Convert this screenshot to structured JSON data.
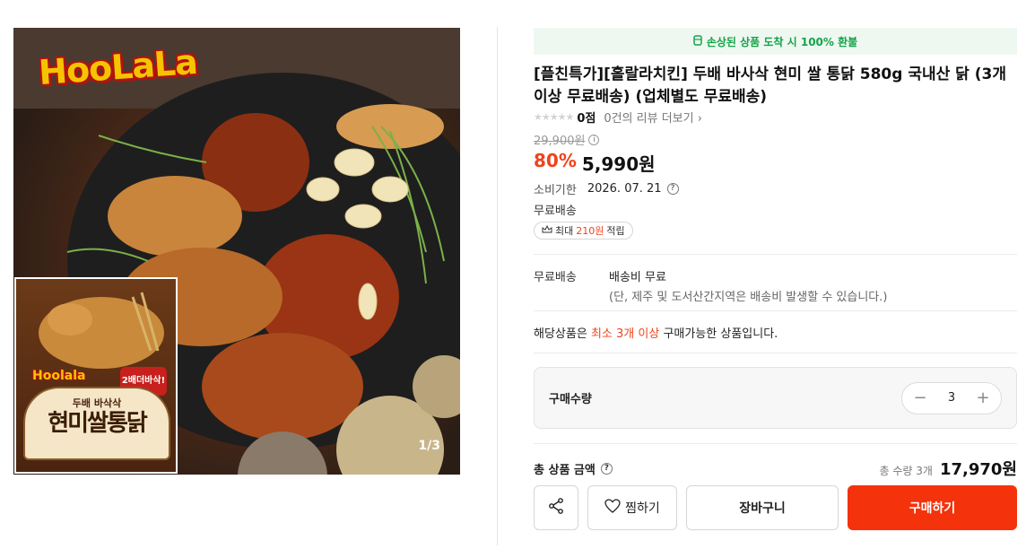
{
  "gallery": {
    "logo_text": "HooLaLa",
    "package": {
      "logo": "Hoolala",
      "subtitle": "두배 바삭삭",
      "title": "현미쌀통닭",
      "badge": "2배더바삭!"
    },
    "counter": "1/3"
  },
  "banner": {
    "icon": "box-icon",
    "text": "손상된 상품 도착 시 100% 환불"
  },
  "product": {
    "title": "[플친특가][홀랄라치킨] 두배 바사삭 현미 쌀 통닭 580g 국내산 닭 (3개이상 무료배송) (업체별도 무료배송)",
    "rating_score": "0점",
    "review_link": "0건의 리뷰 더보기",
    "original_price": "29,900원",
    "discount": "80%",
    "sale_price": "5,990원",
    "expiry_label": "소비기한",
    "expiry_value": "2026. 07. 21",
    "free_shipping": "무료배송",
    "points_prefix": "최대",
    "points_value": "210원",
    "points_suffix": "적립"
  },
  "shipping": {
    "label": "무료배송",
    "title": "배송비 무료",
    "note": "(단, 제주 및 도서산간지역은 배송비 발생할 수 있습니다.)"
  },
  "notice": {
    "prefix": "해당상품은",
    "highlight": "최소 3개 이상",
    "suffix": "구매가능한 상품입니다."
  },
  "quantity": {
    "label": "구매수량",
    "value": "3",
    "minus": "−",
    "plus": "+"
  },
  "total": {
    "label": "총 상품 금액",
    "qty_text": "총 수량 3개",
    "price": "17,970원"
  },
  "actions": {
    "wishlist": "찜하기",
    "cart": "장바구니",
    "buy": "구매하기"
  },
  "colors": {
    "accent": "#f4320b",
    "discount": "#f0431d",
    "banner_bg": "#eef8f1",
    "banner_text": "#16a34a"
  }
}
